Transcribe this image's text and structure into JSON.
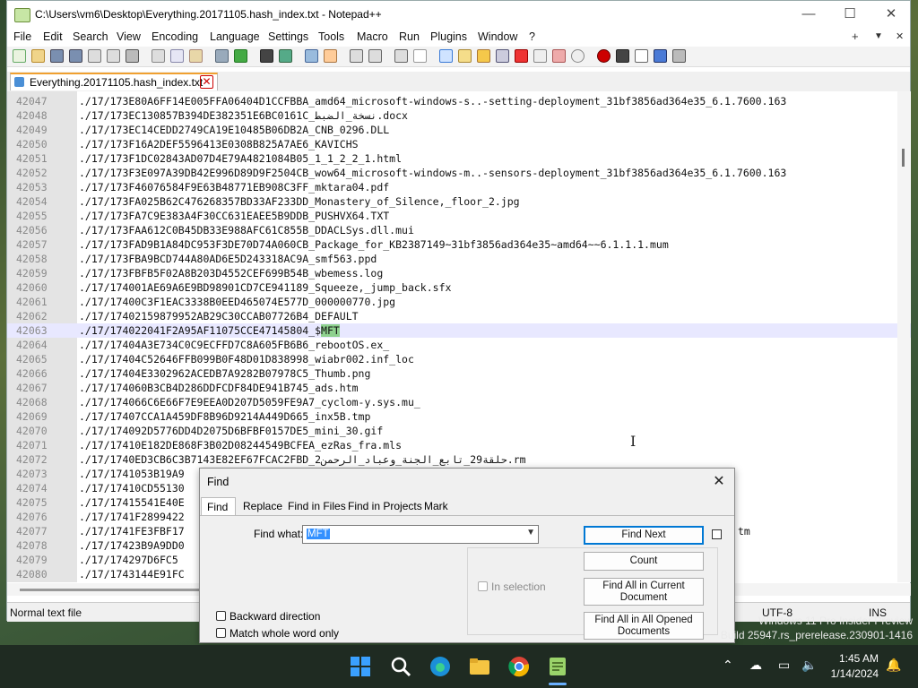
{
  "window": {
    "title": "C:\\Users\\vm6\\Desktop\\Everything.20171105.hash_index.txt - Notepad++",
    "minimize": "—",
    "maximize": "☐",
    "close": "✕"
  },
  "menu": {
    "items": [
      "File",
      "Edit",
      "Search",
      "View",
      "Encoding",
      "Language",
      "Settings",
      "Tools",
      "Macro",
      "Run",
      "Plugins",
      "Window",
      "?"
    ],
    "right_controls": [
      "+",
      "▼",
      "✕"
    ]
  },
  "tab": {
    "label": "Everything.20171105.hash_index.txt",
    "close": "✕"
  },
  "editor": {
    "current_line": 42063,
    "highlight_word": "MFT",
    "lines": [
      {
        "num": "42047",
        "text": "./17/173E80A6FF14E005FFA06404D1CCFBBA_amd64_microsoft-windows-s..-setting-deployment_31bf3856ad364e35_6.1.7600.163"
      },
      {
        "num": "42048",
        "text": "./17/173EC130857B394DE382351E6BC0161C_نسخة_الضبط.docx"
      },
      {
        "num": "42049",
        "text": "./17/173EC14CEDD2749CA19E10485B06DB2A_CNB_0296.DLL"
      },
      {
        "num": "42050",
        "text": "./17/173F16A2DEF5596413E0308B825A7AE6_KAVICHS"
      },
      {
        "num": "42051",
        "text": "./17/173F1DC02843AD07D4E79A4821084B05_1_1_2_2_1.html"
      },
      {
        "num": "42052",
        "text": "./17/173F3E097A39DB42E996D89D9F2504CB_wow64_microsoft-windows-m..-sensors-deployment_31bf3856ad364e35_6.1.7600.163"
      },
      {
        "num": "42053",
        "text": "./17/173F46076584F9E63B48771EB908C3FF_mktara04.pdf"
      },
      {
        "num": "42054",
        "text": "./17/173FA025B62C476268357BD33AF233DD_Monastery_of_Silence,_floor_2.jpg"
      },
      {
        "num": "42055",
        "text": "./17/173FA7C9E383A4F30CC631EAEE5B9DDB_PUSHVX64.TXT"
      },
      {
        "num": "42056",
        "text": "./17/173FAA612C0B45DB33E988AFC61C855B_DDACLSys.dll.mui"
      },
      {
        "num": "42057",
        "text": "./17/173FAD9B1A84DC953F3DE70D74A060CB_Package_for_KB2387149~31bf3856ad364e35~amd64~~6.1.1.1.mum"
      },
      {
        "num": "42058",
        "text": "./17/173FBA9BCD744A80AD6E5D243318AC9A_smf563.ppd"
      },
      {
        "num": "42059",
        "text": "./17/173FBFB5F02A8B203D4552CEF699B54B_wbemess.log"
      },
      {
        "num": "42060",
        "text": "./17/174001AE69A6E9BD98901CD7CE941189_Squeeze,_jump_back.sfx"
      },
      {
        "num": "42061",
        "text": "./17/17400C3F1EAC3338B0EED465074E577D_000000770.jpg"
      },
      {
        "num": "42062",
        "text": "./17/17402159879952AB29C30CCAB07726B4_DEFAULT"
      },
      {
        "num": "42063",
        "text_pre": "./17/174022041F2A95AF11075CCE47145804_$",
        "text_hl": "MFT"
      },
      {
        "num": "42064",
        "text": "./17/17404A3E734C0C9ECFFD7C8A605FB6B6_rebootOS.ex_"
      },
      {
        "num": "42065",
        "text": "./17/17404C52646FFB099B0F48D01D838998_wiabr002.inf_loc"
      },
      {
        "num": "42066",
        "text": "./17/17404E3302962ACEDB7A9282B07978C5_Thumb.png"
      },
      {
        "num": "42067",
        "text": "./17/174060B3CB4D286DDFCDF84DE941B745_ads.htm"
      },
      {
        "num": "42068",
        "text": "./17/174066C6E66F7E9EEA0D207D5059FE9A7_cyclom-y.sys.mu_"
      },
      {
        "num": "42069",
        "text": "./17/17407CCA1A459DF8B96D9214A449D665_inx5B.tmp"
      },
      {
        "num": "42070",
        "text": "./17/174092D5776DD4D2075D6BFBF0157DE5_mini_30.gif"
      },
      {
        "num": "42071",
        "text": "./17/17410E182DE868F3B02D08244549BCFEA_ezRas_fra.mls"
      },
      {
        "num": "42072",
        "text": "./17/1740ED3CB6C3B7143E82EF67FCAC2FBD_حلقة29_تابع_الجنة_وعباد_الرحمن2.rm"
      },
      {
        "num": "42073",
        "text": "./17/1741053B19A9"
      },
      {
        "num": "42074",
        "text": "./17/17410CD55130"
      },
      {
        "num": "42075",
        "text": "./17/17415541E40E"
      },
      {
        "num": "42076",
        "text": "./17/1741F2899422"
      },
      {
        "num": "42077",
        "text": "./17/1741FE3FBF17",
        "tail": "tm"
      },
      {
        "num": "42078",
        "text": "./17/17423B9A9DD0"
      },
      {
        "num": "42079",
        "text": "./17/174297D6FC5"
      },
      {
        "num": "42080",
        "text": "./17/1743144E91FC"
      }
    ]
  },
  "status": {
    "left": "Normal text file",
    "encoding": "UTF-8",
    "mode": "INS"
  },
  "find_dialog": {
    "title": "Find",
    "close": "✕",
    "tabs": [
      "Find",
      "Replace",
      "Find in Files",
      "Find in Projects",
      "Mark"
    ],
    "find_what_label": "Find what:",
    "find_what_value": "MFT",
    "buttons": {
      "find_next": "Find Next",
      "count": "Count",
      "find_all_current": "Find All in Current Document",
      "find_all_opened": "Find All in All Opened Documents"
    },
    "in_selection": "In selection",
    "backward": "Backward direction",
    "match_whole": "Match whole word only"
  },
  "watermark": {
    "line1": "Windows 11 Pro Insider Preview",
    "line2": "Build 25947.rs_prerelease.230901-1416"
  },
  "taskbar": {
    "time": "1:45 AM",
    "date": "1/14/2024",
    "apps": [
      "start-icon",
      "search-icon",
      "edge-icon",
      "file-explorer-icon",
      "chrome-icon",
      "notepadpp-icon"
    ]
  }
}
